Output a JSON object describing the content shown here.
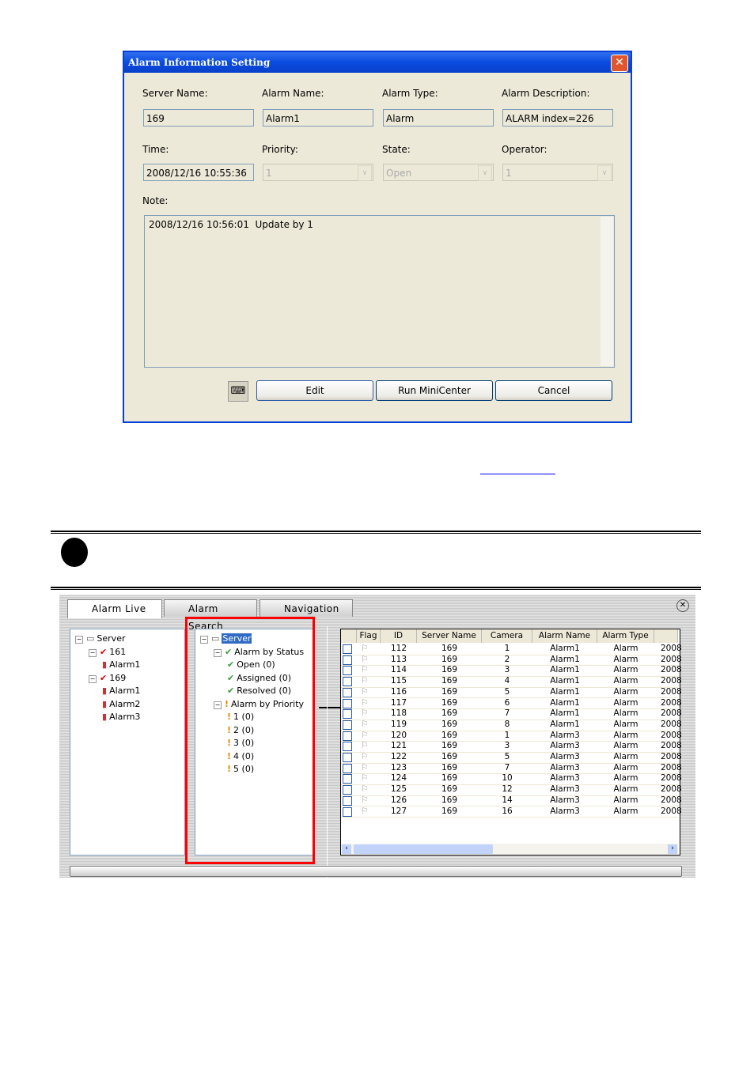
{
  "dialog": {
    "title": "Alarm Information Setting",
    "labels": {
      "server_name": "Server Name:",
      "alarm_name": "Alarm Name:",
      "alarm_type": "Alarm Type:",
      "alarm_description": "Alarm Description:",
      "time": "Time:",
      "priority": "Priority:",
      "state": "State:",
      "operator": "Operator:",
      "note": "Note:"
    },
    "values": {
      "server_name": "169",
      "alarm_name": "Alarm1",
      "alarm_type": "Alarm",
      "alarm_description": "ALARM index=226",
      "time": "2008/12/16 10:55:36",
      "priority": "1",
      "state": "Open",
      "operator": "1"
    },
    "note_text": "2008/12/16 10:56:01  Update by 1",
    "buttons": {
      "edit": "Edit",
      "run": "Run MiniCenter",
      "cancel": "Cancel"
    }
  },
  "panel": {
    "tabs": [
      "Alarm Live",
      "Alarm Search",
      "Navigation"
    ],
    "left_tree": [
      {
        "label": "Server",
        "level": 0,
        "icon": "server-icon"
      },
      {
        "label": "161",
        "level": 1,
        "icon": "server-check-icon"
      },
      {
        "label": "Alarm1",
        "level": 2,
        "icon": "alarm-icon"
      },
      {
        "label": "169",
        "level": 1,
        "icon": "server-check-icon"
      },
      {
        "label": "Alarm1",
        "level": 2,
        "icon": "alarm-icon"
      },
      {
        "label": "Alarm2",
        "level": 2,
        "icon": "alarm-icon"
      },
      {
        "label": "Alarm3",
        "level": 2,
        "icon": "alarm-icon"
      }
    ],
    "middle_tree": [
      {
        "label": "Server",
        "level": 0,
        "icon": "server-icon",
        "selected": true
      },
      {
        "label": "Alarm by Status",
        "level": 1,
        "icon": "check-icon"
      },
      {
        "label": "Open (0)",
        "level": 2,
        "icon": "check-icon"
      },
      {
        "label": "Assigned (0)",
        "level": 2,
        "icon": "check-icon"
      },
      {
        "label": "Resolved (0)",
        "level": 2,
        "icon": "check-icon"
      },
      {
        "label": "Alarm by Priority",
        "level": 1,
        "icon": "warning-icon"
      },
      {
        "label": "1 (0)",
        "level": 2,
        "icon": "warning-icon"
      },
      {
        "label": "2 (0)",
        "level": 2,
        "icon": "warning-icon"
      },
      {
        "label": "3 (0)",
        "level": 2,
        "icon": "warning-icon"
      },
      {
        "label": "4 (0)",
        "level": 2,
        "icon": "warning-icon"
      },
      {
        "label": "5 (0)",
        "level": 2,
        "icon": "warning-icon"
      }
    ],
    "grid": {
      "columns": [
        "Flag",
        "ID",
        "Server Name",
        "Camera",
        "Alarm Name",
        "Alarm Type"
      ],
      "rows": [
        [
          "112",
          "169",
          "1",
          "Alarm1",
          "Alarm",
          "2008"
        ],
        [
          "113",
          "169",
          "2",
          "Alarm1",
          "Alarm",
          "2008"
        ],
        [
          "114",
          "169",
          "3",
          "Alarm1",
          "Alarm",
          "2008"
        ],
        [
          "115",
          "169",
          "4",
          "Alarm1",
          "Alarm",
          "2008"
        ],
        [
          "116",
          "169",
          "5",
          "Alarm1",
          "Alarm",
          "2008"
        ],
        [
          "117",
          "169",
          "6",
          "Alarm1",
          "Alarm",
          "2008"
        ],
        [
          "118",
          "169",
          "7",
          "Alarm1",
          "Alarm",
          "2008"
        ],
        [
          "119",
          "169",
          "8",
          "Alarm1",
          "Alarm",
          "2008"
        ],
        [
          "120",
          "169",
          "1",
          "Alarm3",
          "Alarm",
          "2008"
        ],
        [
          "121",
          "169",
          "3",
          "Alarm3",
          "Alarm",
          "2008"
        ],
        [
          "122",
          "169",
          "5",
          "Alarm3",
          "Alarm",
          "2008"
        ],
        [
          "123",
          "169",
          "7",
          "Alarm3",
          "Alarm",
          "2008"
        ],
        [
          "124",
          "169",
          "10",
          "Alarm3",
          "Alarm",
          "2008"
        ],
        [
          "125",
          "169",
          "12",
          "Alarm3",
          "Alarm",
          "2008"
        ],
        [
          "126",
          "169",
          "14",
          "Alarm3",
          "Alarm",
          "2008"
        ],
        [
          "127",
          "169",
          "16",
          "Alarm3",
          "Alarm",
          "2008"
        ]
      ]
    },
    "highlight_color": "#FF0000"
  }
}
